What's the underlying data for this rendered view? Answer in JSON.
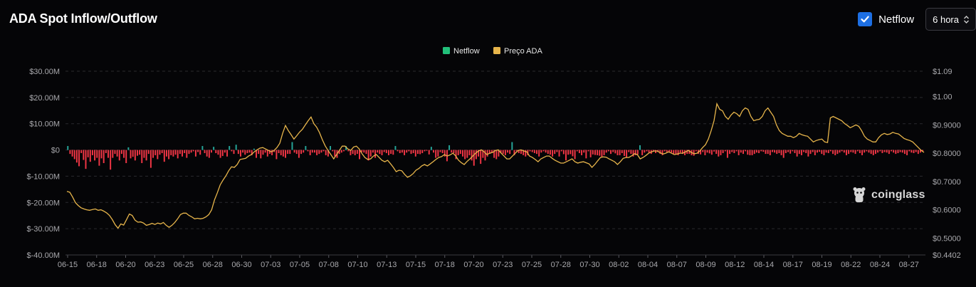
{
  "header": {
    "title": "ADA Spot Inflow/Outflow",
    "netflow_toggle_label": "Netflow",
    "netflow_checked": true,
    "interval_value": "6 hora"
  },
  "watermark": {
    "text": "coinglass"
  },
  "colors": {
    "positive": "#26a69a",
    "negative": "#f23645",
    "price": "#e7b54b",
    "accent": "#1d6fe3",
    "legend_netflow": "#22c07a"
  },
  "chart_data": {
    "type": "bar",
    "legend": [
      {
        "name": "Netflow",
        "color": "#22c07a"
      },
      {
        "name": "Preço ADA",
        "color": "#e7b54b"
      }
    ],
    "y_left": {
      "range": [
        -40000000,
        30000000
      ],
      "ticks": [
        "$30.00M",
        "$20.00M",
        "$10.00M",
        "$0",
        "$-10.00M",
        "$-20.00M",
        "$-30.00M",
        "$-40.00M"
      ]
    },
    "y_right": {
      "range": [
        0.4402,
        1.09
      ],
      "ticks": [
        "$1.09",
        "$1.00",
        "$0.9000",
        "$0.8000",
        "$0.7000",
        "$0.6000",
        "$0.5000",
        "$0.4402"
      ]
    },
    "x_ticks": [
      "06-15",
      "06-18",
      "06-20",
      "06-23",
      "06-25",
      "06-28",
      "06-30",
      "07-03",
      "07-05",
      "07-08",
      "07-10",
      "07-13",
      "07-15",
      "07-18",
      "07-20",
      "07-23",
      "07-25",
      "07-28",
      "07-30",
      "08-02",
      "08-04",
      "08-07",
      "08-09",
      "08-12",
      "08-14",
      "08-17",
      "08-19",
      "08-22",
      "08-24",
      "08-27"
    ],
    "series": [
      {
        "name": "Netflow",
        "unit": "USD million",
        "values": [
          1.5,
          -1.5,
          -2.5,
          -3.5,
          -4.8,
          -6.2,
          -1.2,
          -3.8,
          -7.2,
          -2.8,
          -4.5,
          -2,
          -4,
          -3,
          -6,
          -3.2,
          -5,
          -1.2,
          -3,
          -7.5,
          -3,
          -1.5,
          -2.5,
          -4,
          -1.5,
          -3,
          -5,
          1,
          -3.2,
          -2.6,
          -4,
          -2.2,
          -1.8,
          -5,
          -3,
          -4,
          -1.5,
          -6.8,
          -3,
          -2,
          -3.5,
          -1.8,
          -1.2,
          -4.5,
          -2.5,
          -3.5,
          -2,
          -2.5,
          -1.8,
          -3.2,
          -1.5,
          -2.5,
          -1.2,
          -3,
          -1.5,
          -1,
          -0.5,
          -2.5,
          -0.8,
          -1.8,
          1.5,
          -1.2,
          -2.5,
          -3,
          -1,
          1.2,
          -1.2,
          -1.8,
          -3,
          -2.3,
          -1,
          -2.5,
          1.5,
          -0.5,
          -1.5,
          2,
          -1.5,
          -2.5,
          -1,
          -1.8,
          -1.2,
          -1,
          -2,
          0.5,
          -3,
          -1.5,
          -3.2,
          -1.8,
          -1,
          -2.5,
          -1.5,
          -2,
          -0.8,
          -3.5,
          -1.2,
          -2,
          -2.5,
          -3,
          -1.5,
          -1.5,
          3,
          -1,
          -1.5,
          -3,
          -1.5,
          -1,
          1.5,
          -0.5,
          -2,
          -1,
          -1,
          -2,
          -1.5,
          -1,
          -0.5,
          -2,
          -2.5,
          1.5,
          -0.5,
          -2.5,
          -3,
          -1.5,
          -1,
          -0.5,
          1.5,
          -0.5,
          -2,
          -1.5,
          -2,
          -1.5,
          -3.5,
          -0.8,
          -1,
          -1.5,
          -4,
          -2.5,
          -1,
          -3,
          -1,
          -1.5,
          -2,
          -0.8,
          -1.2,
          -2,
          -1.5,
          -1.8,
          1.5,
          -0.5,
          -1.2,
          -1,
          -2,
          -1,
          -0.5,
          -1.5,
          -1.2,
          -2.5,
          -1.5,
          -1.6,
          -1.2,
          -0.5,
          -0.3,
          -1.7,
          1.2,
          -1,
          -3,
          -2.5,
          -0.8,
          -1.2,
          -2.5,
          -4.3,
          1.8,
          -1,
          -1.2,
          -3.5,
          -2,
          -1.5,
          -2.5,
          -3.5,
          -3,
          -2,
          -4,
          -6,
          -3.5,
          -2.5,
          -5.3,
          -3,
          -4,
          -2.5,
          -1.5,
          -1,
          -3,
          -3.5,
          -2.5,
          -1.2,
          -1.5,
          -2,
          -1,
          -1.5,
          3,
          -2,
          -0.5,
          -1.2,
          -1.5,
          -2,
          -2.5,
          -2,
          -0.5,
          -0.8,
          -1.2,
          -1.5,
          -2.5,
          -1,
          -0.5,
          -1,
          -1.5,
          -1.8,
          -2.5,
          -1.5,
          -0.8,
          -2.5,
          -0.5,
          -1.6,
          -4,
          -1.8,
          -1.6,
          -2.4,
          -3.5,
          -0.5,
          -1.2,
          -2,
          -1,
          -3.2,
          -0.5,
          -2.8,
          -1.7,
          -1.9,
          -2,
          -2.2,
          -2.6,
          -2,
          -1,
          -0.5,
          -1.5,
          -0.8,
          -1.3,
          -2,
          -2,
          -1.2,
          -2.3,
          -3,
          -0.8,
          -1.5,
          -2.5,
          -2,
          -1.7,
          1.8,
          -2,
          -1,
          -0.5,
          -1,
          -1.5,
          -0.5,
          -1.2,
          -0.8,
          -1.5,
          -2,
          -0.5,
          -0.8,
          -1,
          -1,
          -1.5,
          -1.8,
          -2,
          -1,
          -1.5,
          -2,
          -1.5,
          -1.5,
          -2,
          -2.2,
          -0.5,
          -1.5,
          -1.7,
          -0.8,
          -2,
          -1,
          -1.3,
          -1.8,
          -0.6,
          -1.5,
          -2.5,
          -2,
          -1.2,
          -0.5,
          -3,
          -1.5,
          -0.8,
          -1.2,
          -0.5,
          -2,
          -1,
          -1.5,
          -0.5,
          -1.8,
          -2,
          -2,
          -1.5,
          -1,
          -1.2,
          -0.5,
          -0.7,
          -1.5,
          -1.5,
          -2,
          -0.8,
          -1,
          -1.5,
          -1.2,
          -2,
          -3,
          -1.2,
          -0.8,
          -1.4,
          -0.5,
          -1.2,
          -2.5,
          -1.5,
          -2,
          -0.8,
          -1.2,
          -2.5,
          -1.5,
          -0.8,
          -2,
          -1,
          -0.7,
          -1.5,
          -2,
          -1,
          -1.2,
          -0.5,
          -1.5,
          -2,
          -1.5,
          -1,
          -0.5,
          -1,
          -2,
          -1.5,
          -0.8,
          -1,
          -1.5,
          -0.5,
          -1.2,
          -2,
          -1,
          -0.5,
          -1,
          -1.5,
          -2,
          -1.5,
          -1,
          -0.5,
          -1.2,
          -0.8,
          -1,
          -1.5,
          -0.5,
          -1,
          -1.5,
          -1.2,
          -0.8,
          -1,
          -1.5,
          -2,
          -0.5,
          -1,
          -1.2,
          -0.8,
          -1.5,
          -1,
          -0.5
        ]
      },
      {
        "name": "Preço ADA",
        "unit": "USD",
        "values": [
          0.665,
          0.662,
          0.645,
          0.625,
          0.615,
          0.607,
          0.603,
          0.6,
          0.598,
          0.601,
          0.603,
          0.598,
          0.6,
          0.595,
          0.589,
          0.58,
          0.565,
          0.547,
          0.535,
          0.55,
          0.546,
          0.565,
          0.585,
          0.58,
          0.563,
          0.556,
          0.557,
          0.553,
          0.545,
          0.548,
          0.552,
          0.548,
          0.553,
          0.55,
          0.555,
          0.545,
          0.538,
          0.545,
          0.555,
          0.568,
          0.583,
          0.588,
          0.588,
          0.58,
          0.575,
          0.568,
          0.57,
          0.568,
          0.57,
          0.575,
          0.583,
          0.6,
          0.635,
          0.66,
          0.688,
          0.705,
          0.72,
          0.738,
          0.752,
          0.75,
          0.76,
          0.778,
          0.78,
          0.782,
          0.79,
          0.795,
          0.805,
          0.812,
          0.818,
          0.82,
          0.815,
          0.81,
          0.805,
          0.81,
          0.82,
          0.835,
          0.87,
          0.898,
          0.88,
          0.865,
          0.85,
          0.862,
          0.875,
          0.885,
          0.9,
          0.915,
          0.928,
          0.905,
          0.892,
          0.873,
          0.848,
          0.826,
          0.81,
          0.795,
          0.78,
          0.795,
          0.81,
          0.825,
          0.825,
          0.815,
          0.81,
          0.822,
          0.825,
          0.815,
          0.798,
          0.785,
          0.778,
          0.78,
          0.79,
          0.795,
          0.785,
          0.775,
          0.77,
          0.775,
          0.763,
          0.75,
          0.735,
          0.74,
          0.738,
          0.725,
          0.715,
          0.72,
          0.728,
          0.74,
          0.746,
          0.755,
          0.76,
          0.755,
          0.762,
          0.77,
          0.778,
          0.785,
          0.788,
          0.795,
          0.79,
          0.794,
          0.8,
          0.79,
          0.775,
          0.766,
          0.76,
          0.771,
          0.78,
          0.79,
          0.8,
          0.808,
          0.812,
          0.805,
          0.795,
          0.8,
          0.803,
          0.81,
          0.812,
          0.8,
          0.79,
          0.78,
          0.78,
          0.79,
          0.8,
          0.81,
          0.812,
          0.808,
          0.805,
          0.79,
          0.785,
          0.778,
          0.77,
          0.78,
          0.785,
          0.79,
          0.79,
          0.782,
          0.775,
          0.77,
          0.765,
          0.765,
          0.77,
          0.775,
          0.78,
          0.77,
          0.765,
          0.768,
          0.77,
          0.766,
          0.762,
          0.75,
          0.76,
          0.773,
          0.785,
          0.787,
          0.786,
          0.78,
          0.775,
          0.77,
          0.76,
          0.77,
          0.782,
          0.785,
          0.785,
          0.791,
          0.798,
          0.795,
          0.78,
          0.785,
          0.792,
          0.8,
          0.805,
          0.808,
          0.808,
          0.802,
          0.797,
          0.8,
          0.805,
          0.8,
          0.795,
          0.797,
          0.8,
          0.8,
          0.805,
          0.81,
          0.803,
          0.798,
          0.8,
          0.808,
          0.82,
          0.83,
          0.85,
          0.88,
          0.915,
          0.975,
          0.955,
          0.95,
          0.93,
          0.92,
          0.935,
          0.945,
          0.94,
          0.93,
          0.95,
          0.96,
          0.955,
          0.93,
          0.915,
          0.918,
          0.92,
          0.93,
          0.95,
          0.96,
          0.945,
          0.93,
          0.9,
          0.88,
          0.87,
          0.865,
          0.86,
          0.86,
          0.855,
          0.86,
          0.87,
          0.865,
          0.862,
          0.86,
          0.85,
          0.84,
          0.845,
          0.848,
          0.85,
          0.84,
          0.838,
          0.925,
          0.93,
          0.925,
          0.92,
          0.915,
          0.905,
          0.898,
          0.89,
          0.895,
          0.9,
          0.895,
          0.88,
          0.86,
          0.85,
          0.845,
          0.84,
          0.84,
          0.855,
          0.865,
          0.87,
          0.866,
          0.868,
          0.874,
          0.87,
          0.868,
          0.86,
          0.852,
          0.848,
          0.845,
          0.84,
          0.83,
          0.82,
          0.81,
          0.803
        ]
      }
    ]
  }
}
